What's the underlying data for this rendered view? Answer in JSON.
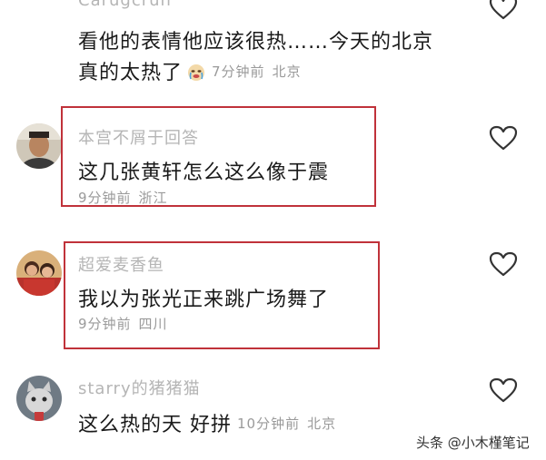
{
  "comments": [
    {
      "username": "Carugcrun",
      "text_line1": "看他的表情他应该很热……今天的北京",
      "text_line2": "真的太热了",
      "time": "7分钟前",
      "location": "北京",
      "emoji": "crying-face-emoji",
      "liked": false,
      "highlighted": false
    },
    {
      "username": "本宫不屑于回答",
      "text": "这几张黄轩怎么这么像于震",
      "time": "9分钟前",
      "location": "浙江",
      "liked": false,
      "highlighted": true
    },
    {
      "username": "超爱麦香鱼",
      "text": "我以为张光正来跳广场舞了",
      "time": "9分钟前",
      "location": "四川",
      "liked": false,
      "highlighted": true
    },
    {
      "username": "starry的猪猪猫",
      "text": "这么热的天 好拼",
      "time": "10分钟前",
      "location": "北京",
      "liked": false,
      "highlighted": false
    }
  ],
  "watermark": "头条 @小木槿笔记",
  "colors": {
    "highlight_border": "#c0323a",
    "text": "#1a1a1a",
    "meta": "#9a9a9a",
    "username": "#b5b5b5"
  },
  "icons": {
    "like": "heart-outline-icon"
  }
}
